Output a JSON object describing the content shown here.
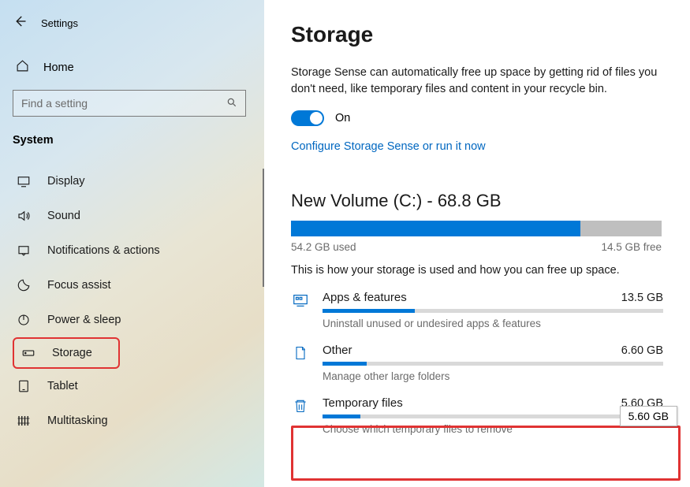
{
  "header": {
    "back": "←",
    "title": "Settings"
  },
  "sidebar": {
    "home": "Home",
    "searchPlaceholder": "Find a setting",
    "category": "System",
    "items": [
      {
        "label": "Display"
      },
      {
        "label": "Sound"
      },
      {
        "label": "Notifications & actions"
      },
      {
        "label": "Focus assist"
      },
      {
        "label": "Power & sleep"
      },
      {
        "label": "Storage"
      },
      {
        "label": "Tablet"
      },
      {
        "label": "Multitasking"
      }
    ]
  },
  "main": {
    "title": "Storage",
    "senseDesc": "Storage Sense can automatically free up space by getting rid of files you don't need, like temporary files and content in your recycle bin.",
    "toggleState": "On",
    "configureLink": "Configure Storage Sense or run it now",
    "volume": {
      "title": "New Volume (C:) - 68.8 GB",
      "used": "54.2 GB used",
      "free": "14.5 GB free",
      "fillPercent": 78
    },
    "usageDesc": "This is how your storage is used and how you can free up space.",
    "items": [
      {
        "name": "Apps & features",
        "size": "13.5 GB",
        "sub": "Uninstall unused or undesired apps & features",
        "fillPercent": 27
      },
      {
        "name": "Other",
        "size": "6.60 GB",
        "sub": "Manage other large folders",
        "fillPercent": 13
      },
      {
        "name": "Temporary files",
        "size": "5.60 GB",
        "sub": "Choose which temporary files to remove",
        "fillPercent": 11
      }
    ],
    "tooltip": "5.60 GB"
  }
}
